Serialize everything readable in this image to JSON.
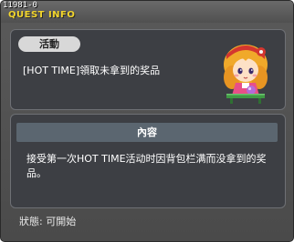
{
  "window": {
    "quest_id": "11981-0",
    "title": "QUEST INFO"
  },
  "quest": {
    "category": "活動",
    "name": "[HOT TIME]領取未拿到的奖品",
    "npc_icon": "npc-girl-portrait-icon"
  },
  "content": {
    "header": "內容",
    "text": "接受第一次HOT TIME活动时因背包栏满而没拿到的奖品。"
  },
  "status": {
    "text": "狀態: 可開始"
  },
  "colors": {
    "title_accent": "#f2d52c",
    "panel_bg": "#3d3f44",
    "header_bg": "#5b6670"
  }
}
